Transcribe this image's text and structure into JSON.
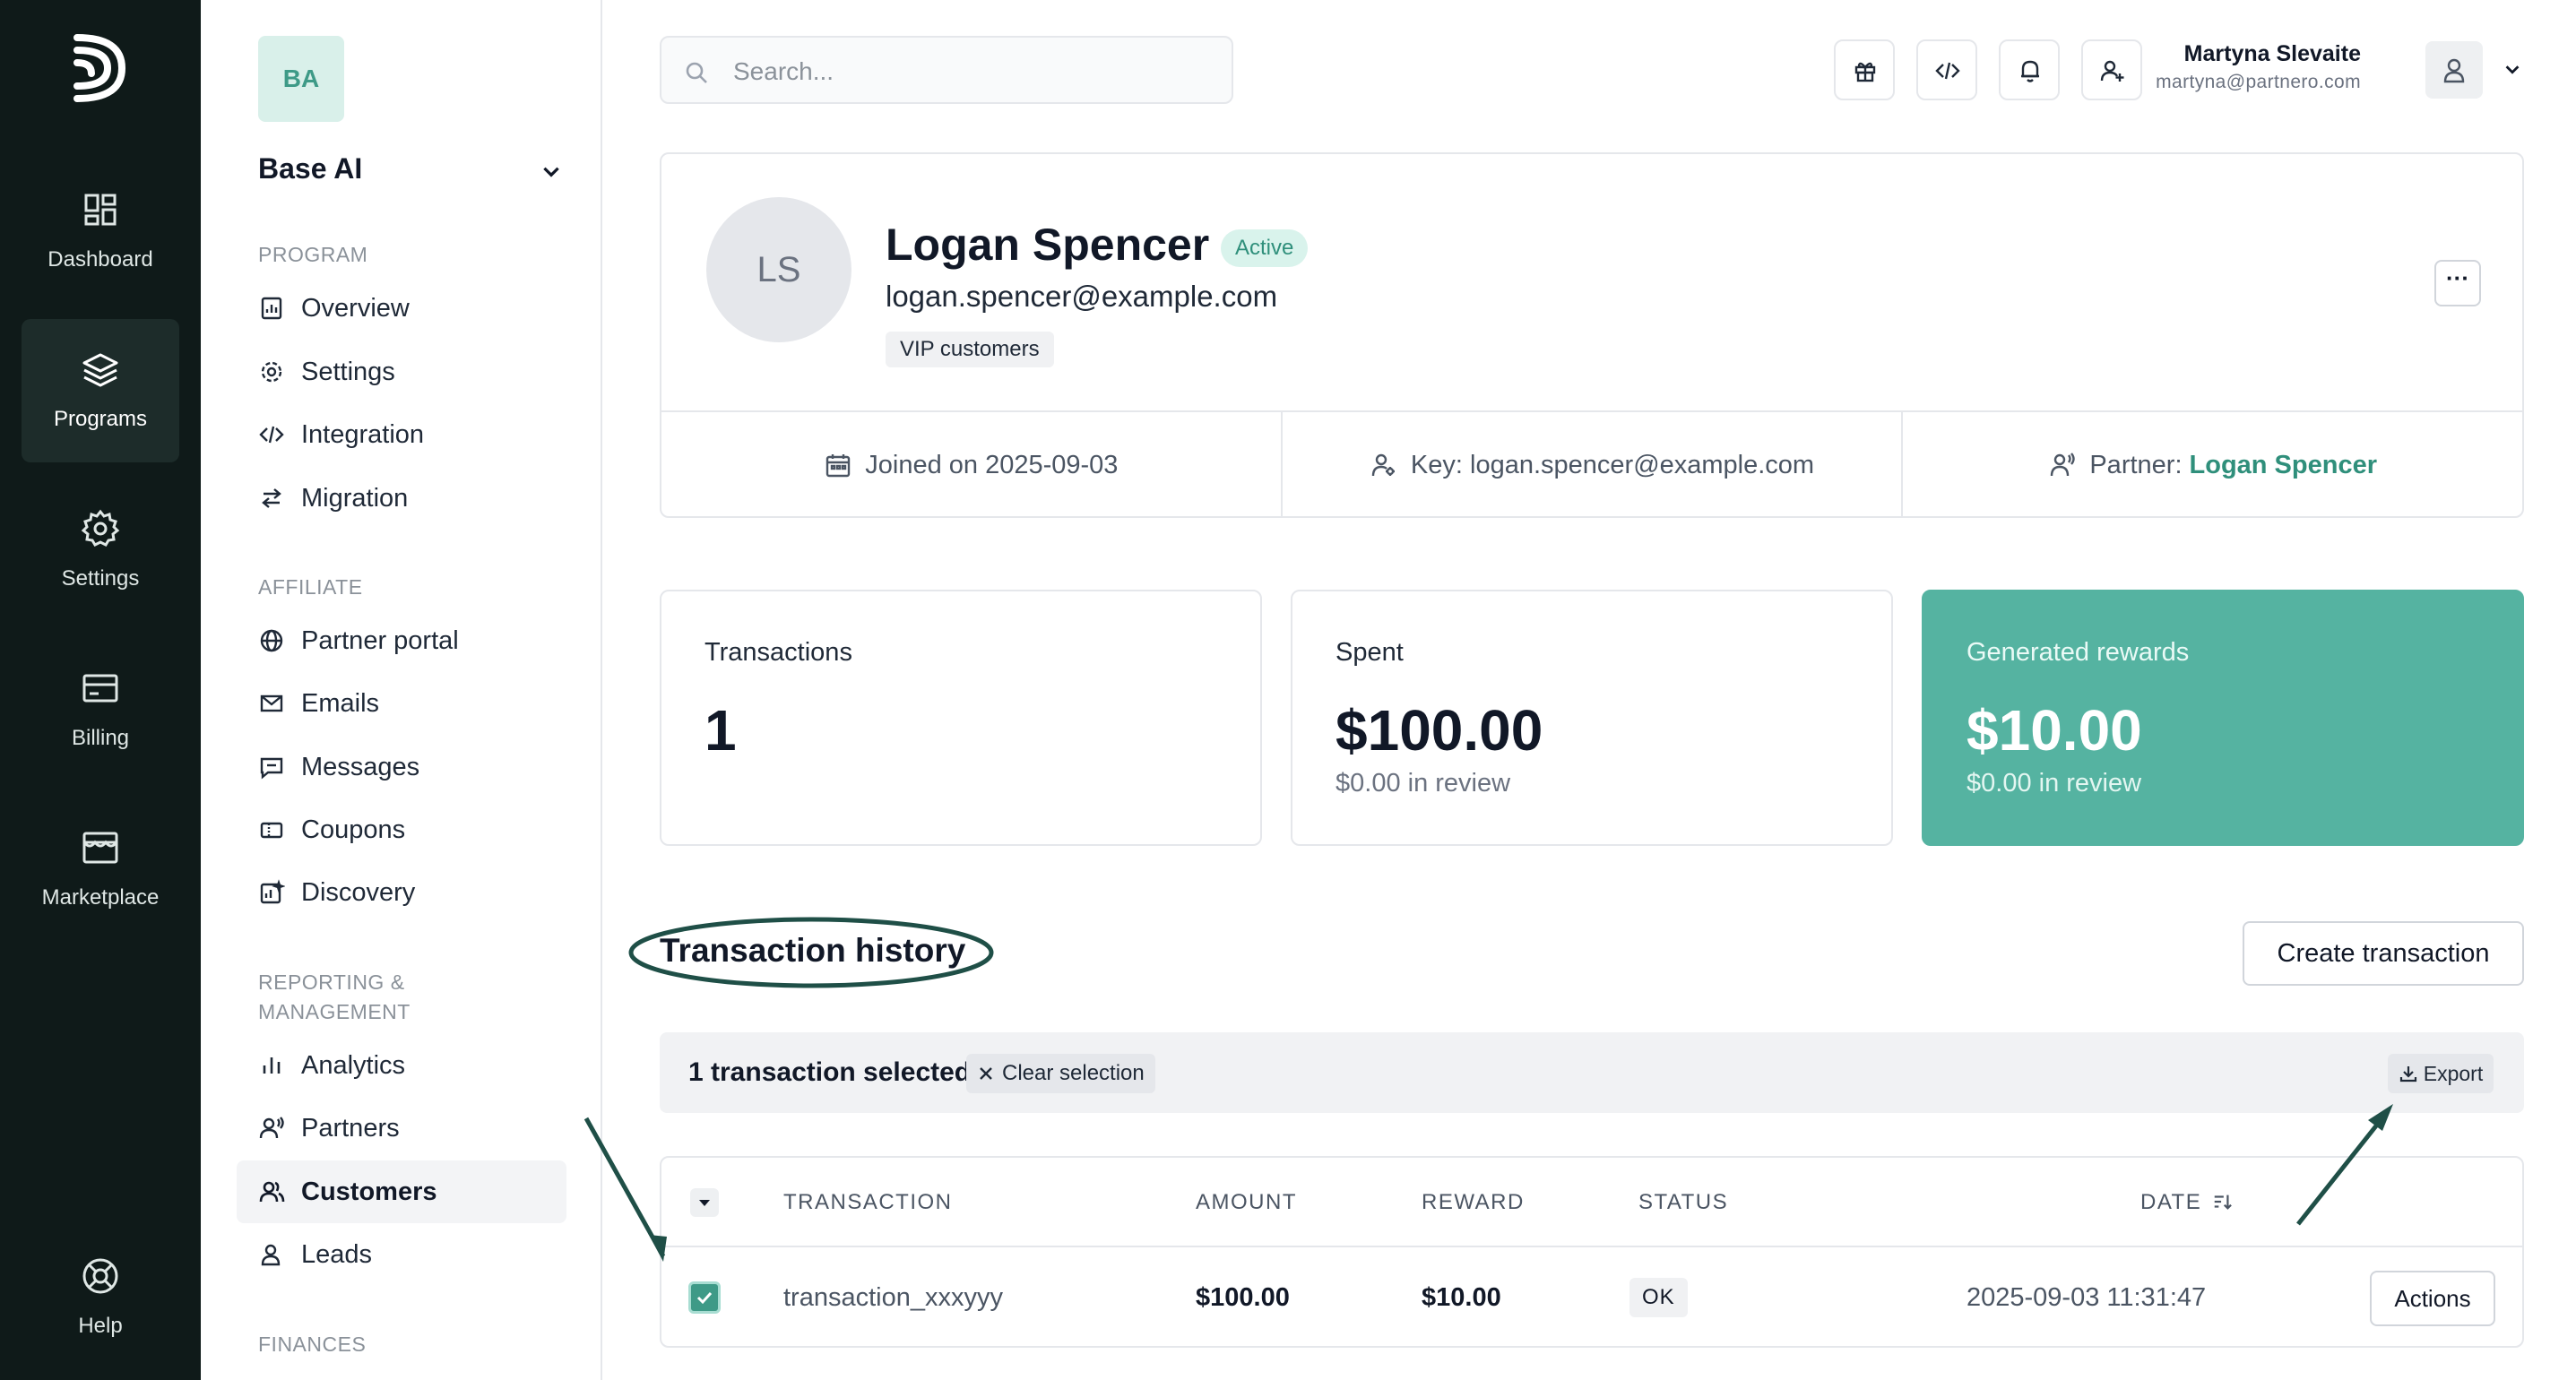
{
  "rail": {
    "items": [
      {
        "label": "Dashboard",
        "icon": "dashboard-icon"
      },
      {
        "label": "Programs",
        "icon": "layers-icon"
      },
      {
        "label": "Settings",
        "icon": "gear-icon"
      },
      {
        "label": "Billing",
        "icon": "billing-icon"
      },
      {
        "label": "Marketplace",
        "icon": "store-icon"
      }
    ],
    "help": {
      "label": "Help",
      "icon": "lifebuoy-icon"
    }
  },
  "sidebar": {
    "workspace_initials": "BA",
    "workspace_name": "Base AI",
    "sections": {
      "program": "PROGRAM",
      "affiliate": "AFFILIATE",
      "reporting": "REPORTING & MANAGEMENT",
      "finances": "FINANCES"
    },
    "items": [
      {
        "label": "Overview",
        "icon": "chart-doc-icon"
      },
      {
        "label": "Settings",
        "icon": "gear-icon"
      },
      {
        "label": "Integration",
        "icon": "code-icon"
      },
      {
        "label": "Migration",
        "icon": "swap-arrows-icon"
      },
      {
        "label": "Partner portal",
        "icon": "globe-icon"
      },
      {
        "label": "Emails",
        "icon": "mail-icon"
      },
      {
        "label": "Messages",
        "icon": "message-icon"
      },
      {
        "label": "Coupons",
        "icon": "coupon-icon"
      },
      {
        "label": "Discovery",
        "icon": "discovery-icon"
      },
      {
        "label": "Analytics",
        "icon": "bar-chart-icon"
      },
      {
        "label": "Partners",
        "icon": "partner-icon"
      },
      {
        "label": "Customers",
        "icon": "users-icon"
      },
      {
        "label": "Leads",
        "icon": "user-icon"
      }
    ]
  },
  "topbar": {
    "search_placeholder": "Search...",
    "user_name": "Martyna Slevaite",
    "user_email": "martyna@partnero.com"
  },
  "profile": {
    "initials": "LS",
    "name": "Logan Spencer",
    "status": "Active",
    "email": "logan.spencer@example.com",
    "tag": "VIP customers",
    "more_label": "···",
    "joined": "Joined on 2025-09-03",
    "key": "Key: logan.spencer@example.com",
    "partner_prefix": "Partner:",
    "partner_name": "Logan Spencer"
  },
  "stats": [
    {
      "label": "Transactions",
      "value": "1",
      "sub": ""
    },
    {
      "label": "Spent",
      "value": "$100.00",
      "sub": "$0.00 in review"
    },
    {
      "label": "Generated rewards",
      "value": "$10.00",
      "sub": "$0.00 in review"
    }
  ],
  "history": {
    "title": "Transaction history",
    "create_label": "Create transaction",
    "selection_text": "1 transaction selected.",
    "clear_label": "Clear selection",
    "export_label": "Export",
    "columns": {
      "transaction": "TRANSACTION",
      "amount": "AMOUNT",
      "reward": "REWARD",
      "status": "STATUS",
      "date": "DATE"
    },
    "rows": [
      {
        "transaction": "transaction_xxxyyy",
        "amount": "$100.00",
        "reward": "$10.00",
        "status": "OK",
        "date": "2025-09-03 11:31:47",
        "actions_label": "Actions",
        "checked": true
      }
    ]
  },
  "colors": {
    "accent": "#55b3a1",
    "rail_bg": "#0f1a19",
    "annotation": "#1f4f47"
  }
}
